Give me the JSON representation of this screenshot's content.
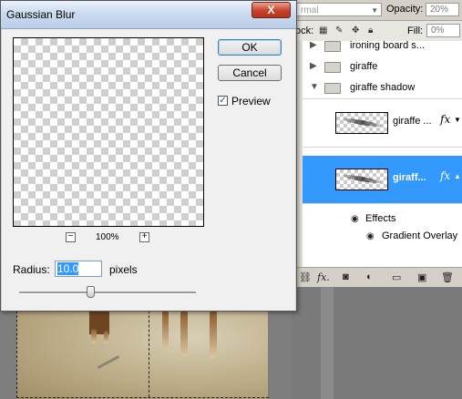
{
  "dialog": {
    "title": "Gaussian Blur",
    "close_label": "X",
    "ok_label": "OK",
    "cancel_label": "Cancel",
    "preview_label": "Preview",
    "preview_checked": true,
    "zoom_out_label": "−",
    "zoom_in_label": "+",
    "zoom_level": "100%",
    "radius_label": "Radius:",
    "radius_value": "10.0",
    "radius_unit": "pixels"
  },
  "options": {
    "blend_mode": "rmal",
    "opacity_label": "Opacity:",
    "opacity_value": "20%",
    "lock_label": "ock:",
    "fill_label": "Fill:",
    "fill_value": "0%"
  },
  "layers": {
    "groups": [
      {
        "name": "ironing board s...",
        "expanded": false
      },
      {
        "name": "giraffe",
        "expanded": false
      },
      {
        "name": "giraffe shadow",
        "expanded": true
      }
    ],
    "items": [
      {
        "name": "giraffe ...",
        "selected": false,
        "fx": "fx"
      },
      {
        "name": "giraff...",
        "selected": true,
        "fx": "fx"
      }
    ],
    "effects_label": "Effects",
    "effect_item": "Gradient Overlay"
  },
  "colors": {
    "selection": "#3399ff",
    "close_button": "#c7422a",
    "dialog_bg": "#f0f0f0"
  },
  "icons": {
    "chain": "link-icon",
    "fx": "fx-icon",
    "mask": "mask-icon",
    "adjustment": "adjustment-icon",
    "new_group": "folder-icon",
    "new_layer": "new-layer-icon",
    "delete": "trash-icon"
  }
}
